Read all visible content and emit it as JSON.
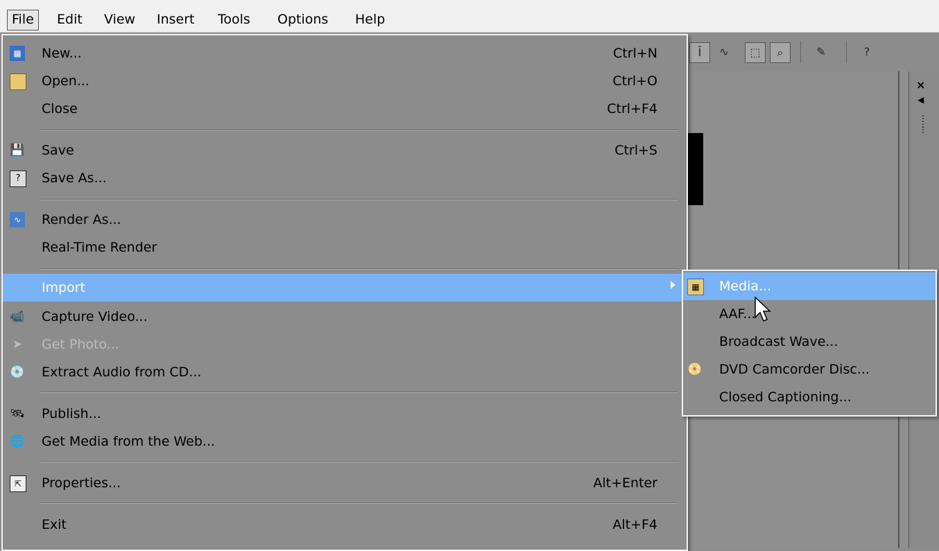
{
  "menubar": {
    "items": [
      "File",
      "Edit",
      "View",
      "Insert",
      "Tools",
      "Options",
      "Help"
    ]
  },
  "file_menu": {
    "items": [
      {
        "label": "New...",
        "shortcut": "Ctrl+N",
        "icon": "new-project-icon"
      },
      {
        "label": "Open...",
        "shortcut": "Ctrl+O",
        "icon": "folder-icon"
      },
      {
        "label": "Close",
        "shortcut": "Ctrl+F4",
        "icon": ""
      },
      {
        "label": "Save",
        "shortcut": "Ctrl+S",
        "icon": "floppy-icon"
      },
      {
        "label": "Save As...",
        "shortcut": "",
        "icon": "save-as-icon"
      },
      {
        "label": "Render As...",
        "shortcut": "",
        "icon": "render-icon"
      },
      {
        "label": "Real-Time Render",
        "shortcut": "",
        "icon": ""
      },
      {
        "label": "Import",
        "shortcut": "",
        "icon": "",
        "submenu": true,
        "highlighted": true
      },
      {
        "label": "Capture Video...",
        "shortcut": "",
        "icon": "capture-video-icon"
      },
      {
        "label": "Get Photo...",
        "shortcut": "",
        "icon": "get-photo-icon",
        "disabled": true
      },
      {
        "label": "Extract Audio from CD...",
        "shortcut": "",
        "icon": "extract-audio-icon"
      },
      {
        "label": "Publish...",
        "shortcut": "",
        "icon": "publish-icon"
      },
      {
        "label": "Get Media from the Web...",
        "shortcut": "",
        "icon": "web-media-icon"
      },
      {
        "label": "Properties...",
        "shortcut": "Alt+Enter",
        "icon": "properties-icon"
      },
      {
        "label": "Exit",
        "shortcut": "Alt+F4",
        "icon": ""
      }
    ]
  },
  "import_menu": {
    "items": [
      {
        "label": "Media...",
        "icon": "media-icon",
        "highlighted": true
      },
      {
        "label": "AAF...",
        "icon": ""
      },
      {
        "label": "Broadcast Wave...",
        "icon": ""
      },
      {
        "label": "DVD Camcorder Disc...",
        "icon": "dvd-camcorder-icon"
      },
      {
        "label": "Closed Captioning...",
        "icon": ""
      }
    ]
  },
  "colors": {
    "highlight": "#79b2f5",
    "menu_bg": "#8c8c8c",
    "menubar_bg": "#f0f0f0"
  }
}
